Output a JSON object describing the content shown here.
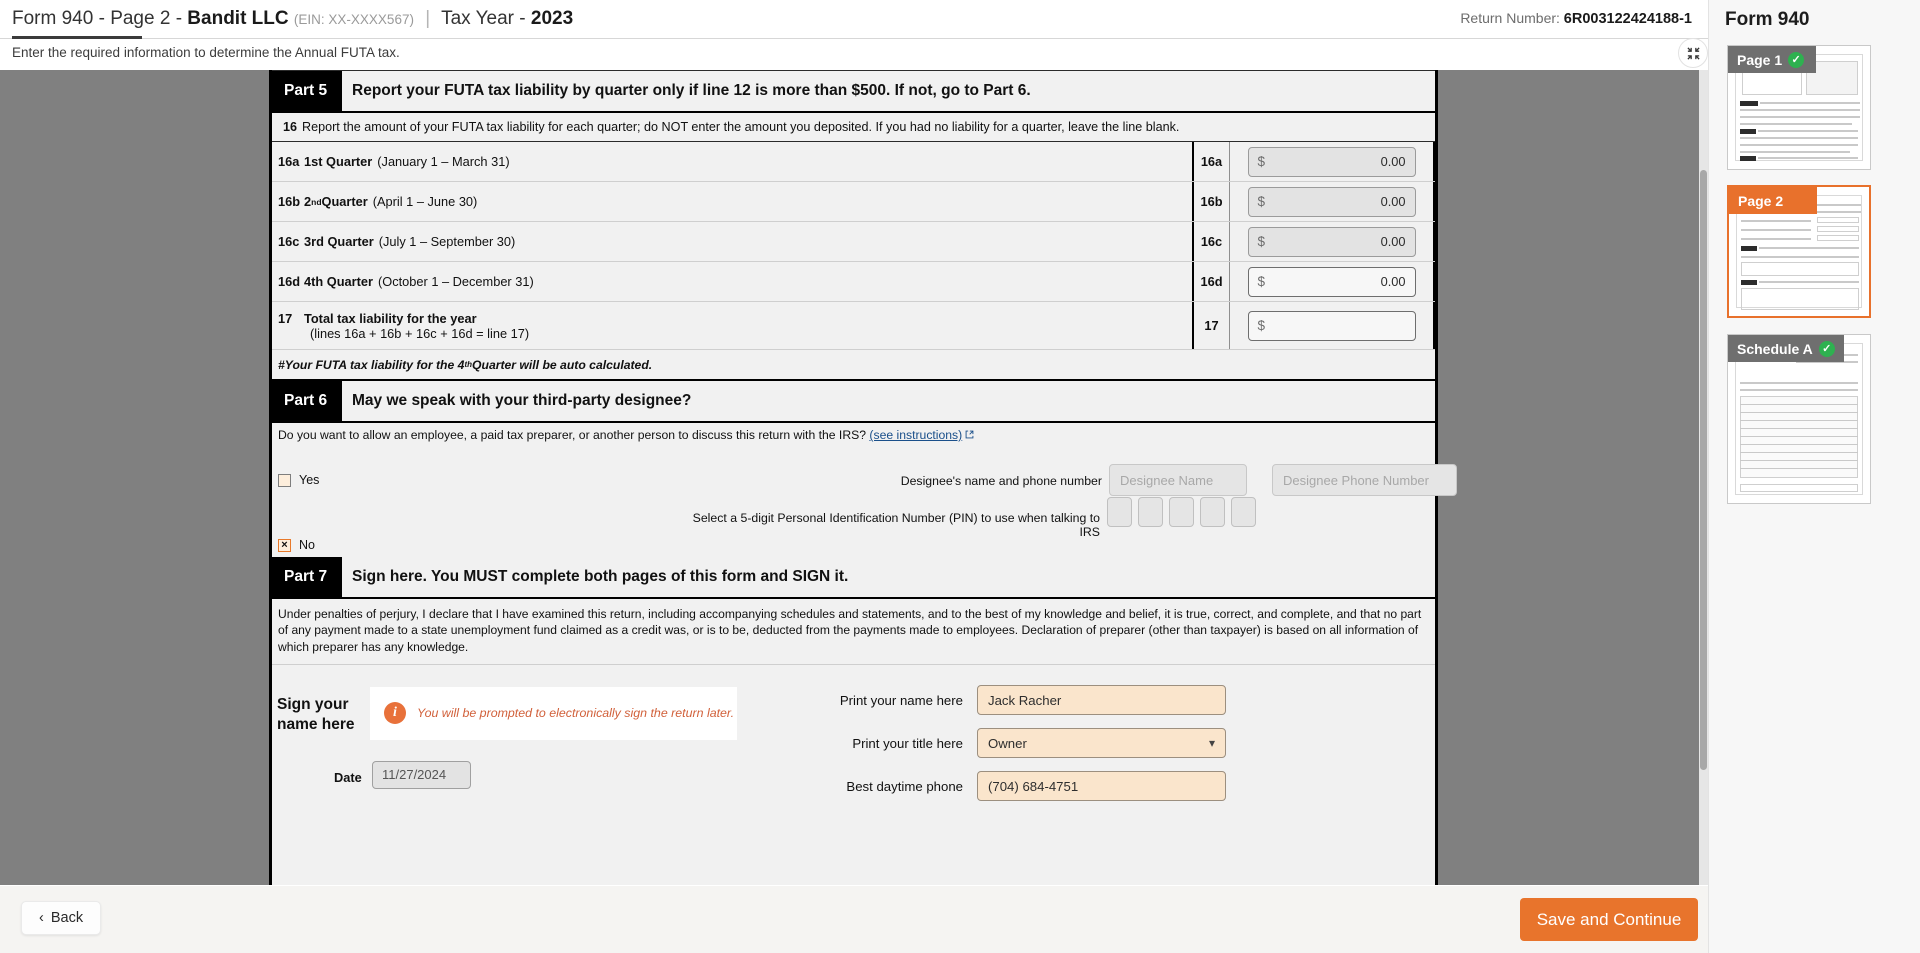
{
  "header": {
    "title_prefix": "Form 940 - Page 2 - ",
    "company": "Bandit LLC",
    "ein": "(EIN: XX-XXXX567)",
    "separator": "|",
    "tax_year_label": "Tax Year - ",
    "tax_year": "2023",
    "return_number_label": "Return Number: ",
    "return_number": "6R003122424188-1",
    "subtitle": "Enter the required information to determine the Annual FUTA tax.",
    "collapse_icon": "collapse-icon"
  },
  "part5": {
    "tag": "Part 5",
    "title": "Report your FUTA tax liability by quarter only if line 12 is more than $500. If not, go to Part 6.",
    "line16_num": "16",
    "line16_text": "Report the amount of your FUTA tax liability for each quarter; do NOT enter the amount you deposited. If you had no liability for a quarter, leave the line blank.",
    "rows": [
      {
        "code": "16a",
        "strong": "1st Quarter",
        "sup": "",
        "paren": "(January 1 – March 31)",
        "box_code": "16a",
        "dollar": "$",
        "value": "0.00",
        "enabled": false
      },
      {
        "code": "16b",
        "strong": "2",
        "sup": "nd",
        "strong2": " Quarter",
        "paren": "(April 1 – June 30)",
        "box_code": "16b",
        "dollar": "$",
        "value": "0.00",
        "enabled": false
      },
      {
        "code": "16c",
        "strong": "3rd Quarter",
        "sup": "",
        "paren": "(July 1 – September 30)",
        "box_code": "16c",
        "dollar": "$",
        "value": "0.00",
        "enabled": false
      },
      {
        "code": "16d",
        "strong": "4th Quarter",
        "sup": "",
        "paren": "(October 1 – December 31)",
        "box_code": "16d",
        "dollar": "$",
        "value": "0.00",
        "enabled": true
      }
    ],
    "line17": {
      "code": "17",
      "label": "Total tax liability for the year",
      "sublabel": "(lines 16a + 16b + 16c + 16d = line 17)",
      "box_code": "17",
      "dollar": "$",
      "value": "",
      "enabled": true
    },
    "footnote_pre": "#Your FUTA tax liability for the 4",
    "footnote_sup": "th",
    "footnote_post": " Quarter will be auto calculated."
  },
  "part6": {
    "tag": "Part 6",
    "title": "May we speak with your third-party designee?",
    "question": "Do you want to allow an employee, a paid tax preparer, or another person to discuss this return with the IRS?",
    "instructions_link": "(see instructions)",
    "yes_label": "Yes",
    "no_label": "No",
    "yes_checked": false,
    "no_checked": true,
    "no_mark": "×",
    "designee_label": "Designee's name and phone number",
    "designee_name_placeholder": "Designee Name",
    "designee_name_value": "",
    "designee_phone_placeholder": "Designee Phone Number",
    "designee_phone_value": "",
    "pin_label": "Select a 5-digit Personal Identification Number (PIN) to use when talking to IRS",
    "pin_digits": [
      "",
      "",
      "",
      "",
      ""
    ]
  },
  "part7": {
    "tag": "Part 7",
    "title": "Sign here. You MUST complete both pages of this form and SIGN it.",
    "declaration": "Under penalties of perjury, I declare that I have examined this return, including accompanying schedules and statements, and to the best of my knowledge and belief, it is true, correct, and complete, and that no part of any payment made to a state unemployment fund claimed as a credit was, or is to be, deducted from the payments made to employees. Declaration of preparer (other than taxpayer) is based on all information of which preparer has any knowledge.",
    "sign_label": "Sign your\nname here",
    "sign_label_line1": "Sign your",
    "sign_label_line2": "name here",
    "info_icon": "info-icon",
    "info_message": "You will be prompted to electronically sign the return later.",
    "date_label": "Date",
    "date_value": "11/27/2024",
    "fields": [
      {
        "label": "Print your name here",
        "value": "Jack Racher",
        "type": "text"
      },
      {
        "label": "Print your title here",
        "value": "Owner",
        "type": "select"
      },
      {
        "label": "Best daytime phone",
        "value": "(704) 684-4751",
        "type": "text"
      }
    ]
  },
  "sidebar": {
    "title": "Form 940",
    "thumbnails": [
      {
        "label": "Page 1",
        "state": "complete",
        "active": false,
        "check_icon": "check-icon"
      },
      {
        "label": "Page 2",
        "state": "active",
        "active": true,
        "check_icon": ""
      },
      {
        "label": "Schedule A",
        "state": "complete",
        "active": false,
        "check_icon": "check-icon"
      }
    ]
  },
  "footer": {
    "back_label": "Back",
    "back_icon": "chevron-left-icon",
    "save_label": "Save and Continue"
  },
  "colors": {
    "accent_orange": "#e8742c",
    "success_green": "#2eb150",
    "viewer_grey": "#808080",
    "form_grey": "#f1f1f1",
    "field_cream": "#fae5cc"
  }
}
